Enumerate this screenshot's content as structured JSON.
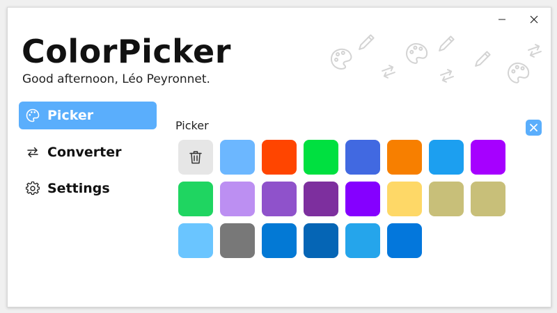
{
  "app": {
    "title": "ColorPicker",
    "greeting": "Good afternoon, Léo Peyronnet."
  },
  "window_controls": {
    "minimize_icon": "minimize-icon",
    "close_icon": "close-icon"
  },
  "nav": {
    "items": [
      {
        "label": "Picker",
        "icon": "palette-icon",
        "active": true
      },
      {
        "label": "Converter",
        "icon": "swap-arrows-icon",
        "active": false
      },
      {
        "label": "Settings",
        "icon": "gear-icon",
        "active": false
      }
    ]
  },
  "picker": {
    "title": "Picker",
    "delete_icon": "trash-icon",
    "colors": [
      "#6cb7ff",
      "#ff4500",
      "#00e040",
      "#4169e1",
      "#f77f00",
      "#1c9ff0",
      "#a600ff",
      "#1fd561",
      "#bc8ff2",
      "#8f52cb",
      "#7d2f9e",
      "#8500ff",
      "#fed867",
      "#c8bf79",
      "#c8bf79",
      "#6ac5ff",
      "#787878",
      "#0379d5",
      "#0565b5",
      "#25a5eb",
      "#0377dc"
    ]
  },
  "theme": {
    "accent": "#5aaefc"
  }
}
